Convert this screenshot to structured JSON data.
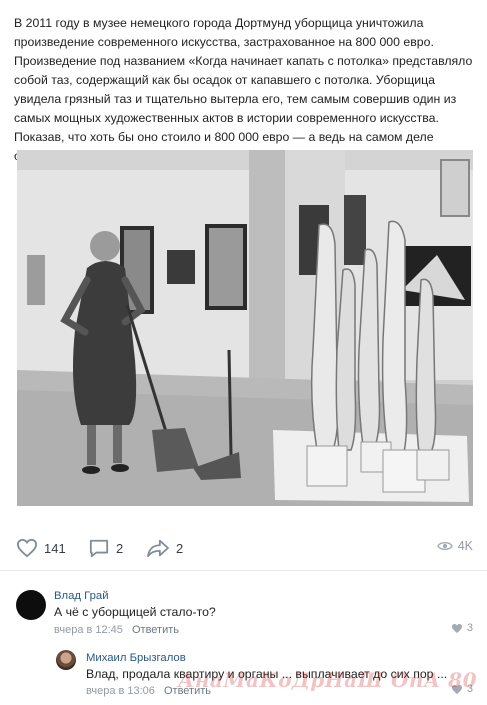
{
  "post": {
    "text": "В 2011 году в музее немецкого города Дортмунд уборщица уничтожила произведение современного искусства, застрахованное на 800 000 евро. Произведение под названием «Когда начинает капать с потолка» представляло собой таз, содержащий как бы осадок от капавшего с потолка. Уборщица увидела грязный таз и тщательно вытерла его, тем самым совершив один из самых мощных художественных актов в истории современного искусства. Показав, что хоть бы оно стоило и 800 000 евро — а ведь на самом деле обыкновенная грязь."
  },
  "actions": {
    "likes": "141",
    "comments": "2",
    "shares": "2",
    "views": "4K",
    "icons": [
      "heart-icon",
      "comment-icon",
      "share-icon",
      "eye-icon"
    ]
  },
  "comments": [
    {
      "author": "Влад Грай",
      "text": "А чё с уборщицей стало-то?",
      "time": "вчера в 12:45",
      "reply_label": "Ответить",
      "likes": "3"
    },
    {
      "author": "Михаил Брызгалов",
      "text": "Влад, продала квартиру и органы ... выплачивает до сих пор ...",
      "time": "вчера в 13:06",
      "reply_label": "Ответить",
      "likes": "3"
    }
  ],
  "watermark": "АнаМаКоДрНаШ ОпА 80",
  "colors": {
    "text": "#222222",
    "link": "#2a5885",
    "muted": "#939aa3",
    "divider": "#e7e8ec"
  }
}
